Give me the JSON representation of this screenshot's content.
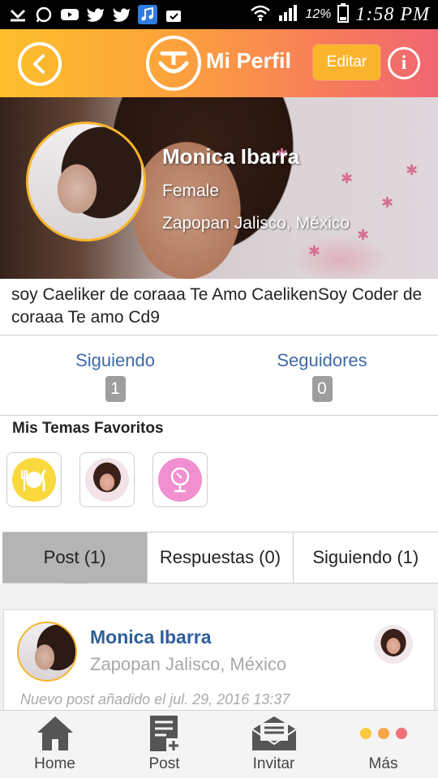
{
  "status_bar": {
    "battery": "12%",
    "time": "1:58 PM"
  },
  "header": {
    "title": "Mi Perfil",
    "edit_label": "Editar",
    "info_glyph": "i"
  },
  "profile": {
    "name": "Monica Ibarra",
    "gender": "Female",
    "location": "Zapopan Jalisco, México",
    "bio": "soy Caeliker de coraaa Te Amo CaelikenSoy Coder de coraaa Te amo Cd9"
  },
  "stats": {
    "following_label": "Siguiendo",
    "following_count": "1",
    "followers_label": "Seguidores",
    "followers_count": "0"
  },
  "favorites": {
    "title": "Mis Temas Favoritos",
    "items": [
      "food-icon",
      "person-photo",
      "mirror-icon"
    ]
  },
  "tabs": {
    "post": "Post (1)",
    "replies": "Respuestas (0)",
    "following": "Siguiendo (1)"
  },
  "post": {
    "name": "Monica Ibarra",
    "location": "Zapopan Jalisco, México",
    "date": "Nuevo post añadido el jul. 29, 2016 13:37"
  },
  "nav": {
    "home": "Home",
    "post": "Post",
    "invite": "Invitar",
    "more": "Más"
  },
  "colors": {
    "header_start": "#fcbf2b",
    "header_end": "#f06673",
    "link_blue": "#3e6aa8",
    "avatar_border": "#f7b52b"
  }
}
